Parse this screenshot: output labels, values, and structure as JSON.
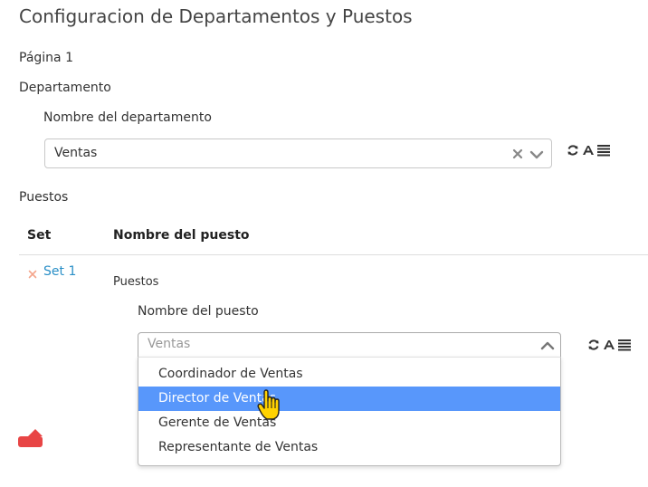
{
  "page": {
    "title": "Configuracion de Departamentos y Puestos",
    "page_label": "Página 1"
  },
  "departamento": {
    "section_label": "Departamento",
    "field_label": "Nombre del departamento",
    "value": "Ventas",
    "icons": [
      "clear-icon",
      "chevron-down-icon",
      "refresh-icon",
      "text-format-icon",
      "list-icon"
    ]
  },
  "puestos": {
    "section_label": "Puestos",
    "columns": [
      "Set",
      "Nombre del puesto"
    ],
    "set_label": "Set 1",
    "inner_section_label": "Puestos",
    "field_label": "Nombre del puesto",
    "placeholder": "Ventas",
    "options": [
      "Coordinador de Ventas",
      "Director de Ventas",
      "Gerente de Ventas",
      "Representante de Ventas"
    ],
    "highlighted_option": "Director de Ventas",
    "icons": [
      "chevron-up-icon",
      "refresh-icon",
      "text-format-icon",
      "list-icon",
      "remove-icon"
    ]
  },
  "colors": {
    "highlight": "#5897fb",
    "link": "#2a8fc7",
    "remove": "#f4a58c",
    "danger": "#e84545"
  }
}
